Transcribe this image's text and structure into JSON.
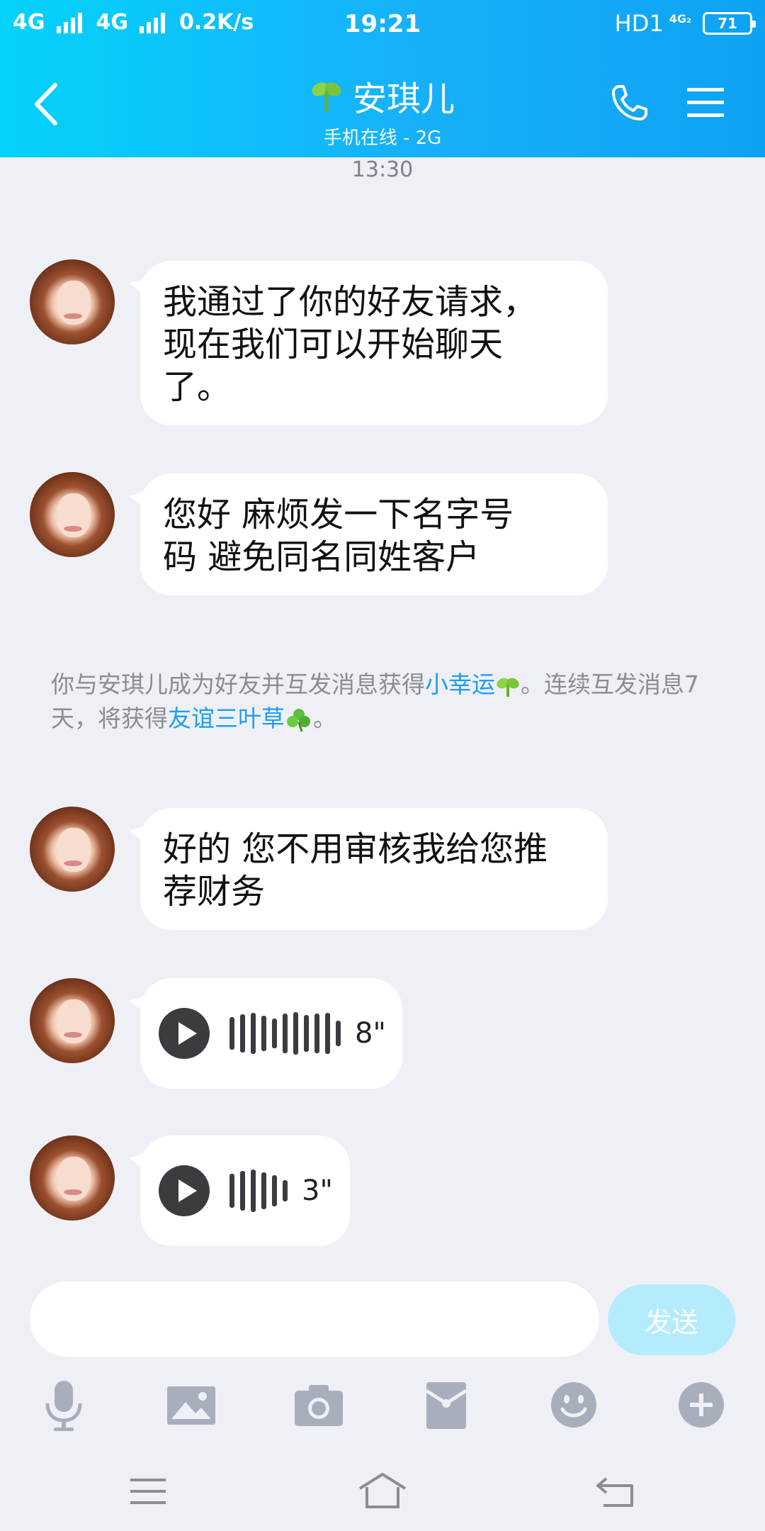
{
  "status_bar": {
    "network1": "4G",
    "network2": "4G",
    "speed": "0.2K/s",
    "time": "19:21",
    "hd": "HD1",
    "net_badge": "4G₂",
    "battery": "71"
  },
  "header": {
    "contact_name": "安琪儿",
    "contact_status": "手机在线 - 2G",
    "icons": [
      "back-arrow-icon",
      "clover-sprout-icon",
      "phone-icon",
      "menu-icon"
    ]
  },
  "chat": {
    "timestamp": "13:30",
    "messages": [
      {
        "type": "text",
        "text": "我通过了你的好友请求，\n现在我们可以开始聊天\n了。"
      },
      {
        "type": "text",
        "text": "您好   麻烦发一下名字号\n码 避免同名同姓客户"
      },
      {
        "type": "text",
        "text": "好的  您不用审核我给您推\n荐财务"
      },
      {
        "type": "voice",
        "duration": "8\""
      },
      {
        "type": "voice",
        "duration": "3\""
      }
    ],
    "system_notice": {
      "part1": "你与安琪儿成为好友并互发消息获得",
      "highlight1": "小幸运",
      "part2": "。连续互发消息7天，将获得",
      "highlight2": "友谊三叶草",
      "part3": "。"
    }
  },
  "composer": {
    "input_value": "",
    "send_label": "发送",
    "tools": [
      "microphone-icon",
      "image-icon",
      "camera-icon",
      "red-packet-icon",
      "emoji-icon",
      "plus-icon"
    ]
  },
  "nav_bar": [
    "menu-nav-icon",
    "home-nav-icon",
    "back-nav-icon"
  ],
  "colors": {
    "header_start": "#04d2fc",
    "header_end": "#0ea2f3",
    "background": "#eef0f5",
    "highlight": "#1e9ef0",
    "send_disabled": "#b5ecfd"
  }
}
